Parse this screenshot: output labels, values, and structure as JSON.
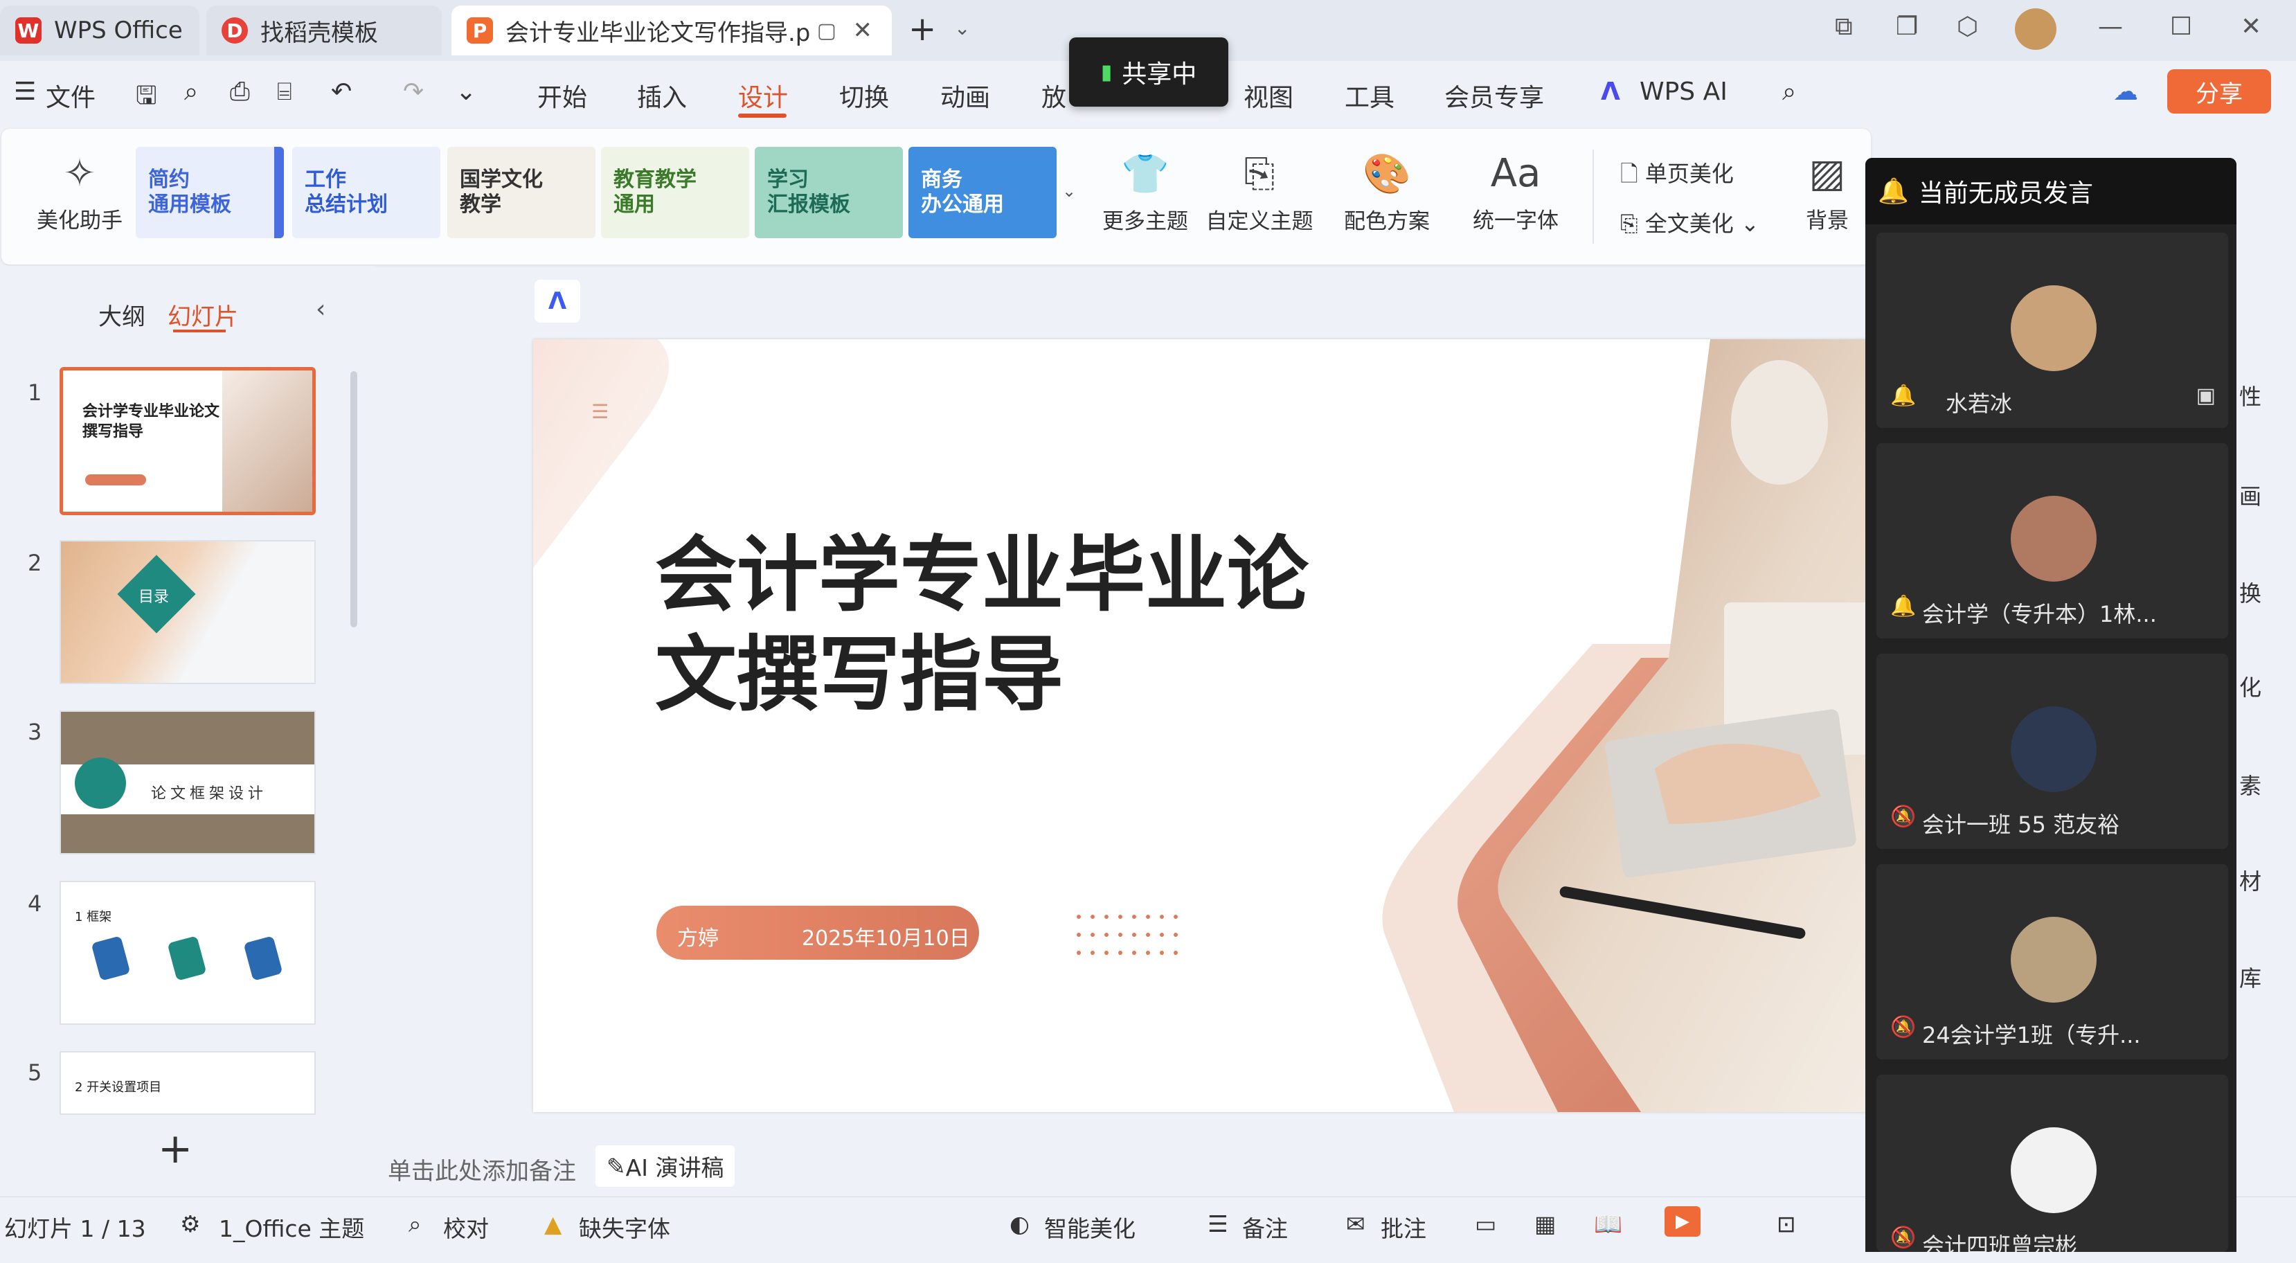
{
  "titlebar": {
    "tabs": [
      {
        "label": "WPS Office"
      },
      {
        "label": "找稻壳模板"
      },
      {
        "label": "会计专业毕业论文写作指导.p"
      }
    ],
    "new_tab": "+"
  },
  "menu": {
    "file": "文件",
    "items": [
      "开始",
      "插入",
      "设计",
      "切换",
      "动画",
      "放",
      "视图",
      "工具",
      "会员专享"
    ],
    "active": "设计",
    "wps_ai": "WPS AI",
    "share": "分享"
  },
  "sharing_badge": "共享中",
  "ribbon": {
    "beautify": "美化助手",
    "templates": [
      {
        "label": "简约\n通用模板",
        "color": "#3d64d8"
      },
      {
        "label": "工作\n总结计划",
        "color": "#2f5bd6"
      },
      {
        "label": "国学文化\n教学",
        "color": "#333333"
      },
      {
        "label": "教育教学\n通用",
        "color": "#3a7a2a"
      },
      {
        "label": "学习\n汇报模板",
        "color": "#1e6b55"
      },
      {
        "label": "商务\n办公通用",
        "color": "#ffffff"
      }
    ],
    "buttons": [
      "更多主题",
      "自定义主题",
      "配色方案",
      "统一字体"
    ],
    "single_page": "单页美化",
    "full_page": "全文美化",
    "background": "背景"
  },
  "left_panel": {
    "tab_outline": "大纲",
    "tab_slides": "幻灯片",
    "slides": [
      {
        "num": "1",
        "title": "会计学专业毕业论文撰写指导"
      },
      {
        "num": "2",
        "title": "目录"
      },
      {
        "num": "3",
        "title": "论文框架设计"
      },
      {
        "num": "4",
        "title": "1 框架"
      },
      {
        "num": "5",
        "title": "2 开关设置项目"
      }
    ],
    "add": "+"
  },
  "slide": {
    "title_line1": "会计学专业毕业论",
    "title_line2": "文撰写指导",
    "presenter": "方婷",
    "date": "2025年10月10日"
  },
  "notes": {
    "placeholder": "单击此处添加备注",
    "ai_button": "AI 演讲稿"
  },
  "status": {
    "slide_count": "幻灯片 1 / 13",
    "theme": "1_Office 主题",
    "proof": "校对",
    "missing_font": "缺失字体",
    "smart_beautify": "智能美化",
    "notes": "备注",
    "comments": "批注"
  },
  "meeting": {
    "header": "当前无成员发言",
    "members": [
      {
        "name": "水若冰",
        "avatar_color": "#c9a27a"
      },
      {
        "name": "会计学（专升本）1林...",
        "avatar_color": "#b07a62"
      },
      {
        "name": "会计一班 55 范友裕",
        "avatar_color": "#2d3950"
      },
      {
        "name": "24会计学1班（专升...",
        "avatar_color": "#b9a07f"
      },
      {
        "name": "会计四班曾宗彬",
        "avatar_color": "#f2f2f2"
      }
    ]
  },
  "right_strip": [
    "性",
    "画",
    "换",
    "化",
    "素",
    "材",
    "库"
  ],
  "colors": {
    "accent": "#e0522a",
    "share": "#f06a38",
    "slide_pill": "#e07a5c"
  }
}
